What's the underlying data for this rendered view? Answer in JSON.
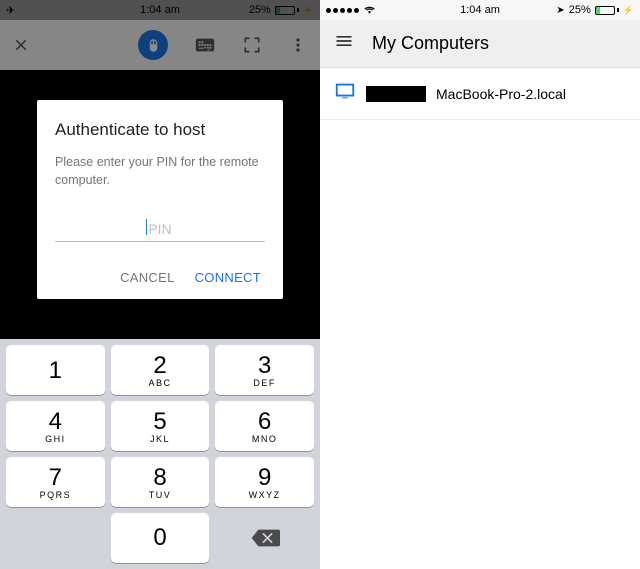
{
  "status": {
    "time": "1:04 am",
    "battery_pct": "25%"
  },
  "left": {
    "dialog": {
      "title": "Authenticate to host",
      "message": "Please enter your PIN for the remote computer.",
      "placeholder": "PIN",
      "cancel": "CANCEL",
      "connect": "CONNECT"
    },
    "keypad": [
      {
        "num": "1",
        "sub": ""
      },
      {
        "num": "2",
        "sub": "ABC"
      },
      {
        "num": "3",
        "sub": "DEF"
      },
      {
        "num": "4",
        "sub": "GHI"
      },
      {
        "num": "5",
        "sub": "JKL"
      },
      {
        "num": "6",
        "sub": "MNO"
      },
      {
        "num": "7",
        "sub": "PQRS"
      },
      {
        "num": "8",
        "sub": "TUV"
      },
      {
        "num": "9",
        "sub": "WXYZ"
      },
      {
        "num": "0",
        "sub": ""
      }
    ]
  },
  "right": {
    "title": "My Computers",
    "computer_name": "MacBook-Pro-2.local"
  }
}
